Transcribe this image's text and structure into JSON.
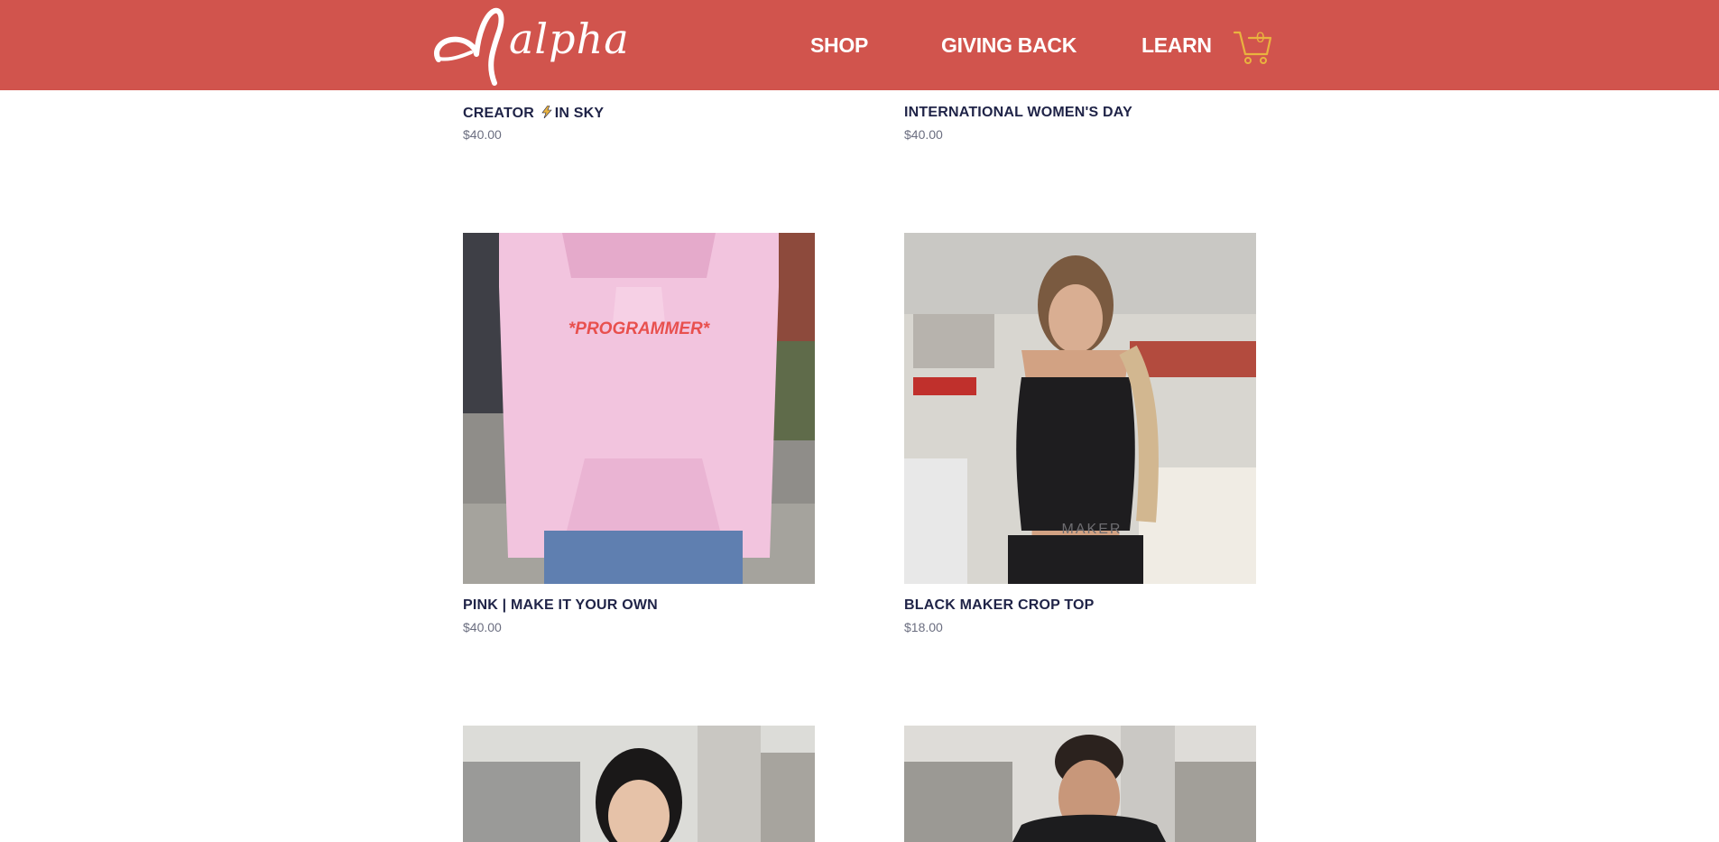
{
  "header": {
    "logo_text": "alpha",
    "nav": {
      "shop": "SHOP",
      "giving_back": "GIVING BACK",
      "learn": "LEARN"
    },
    "cart_count": "0"
  },
  "colors": {
    "header_bg": "#d1544d",
    "cart_accent": "#e9b33f",
    "product_name": "#1f2347",
    "price_text": "#6b6e80"
  },
  "products": [
    {
      "name_part1": "CREATOR",
      "name_icon": "lightning-icon",
      "name_part2": "IN SKY",
      "price": "$40.00"
    },
    {
      "name": "INTERNATIONAL WOMEN'S DAY",
      "price": "$40.00"
    },
    {
      "name": "PINK | MAKE IT YOUR OWN",
      "price": "$40.00",
      "image_text": "*PROGRAMMER*"
    },
    {
      "name": "BLACK MAKER CROP TOP",
      "price": "$18.00",
      "image_text": "MAKER"
    },
    {
      "name": "",
      "price": ""
    },
    {
      "name": "",
      "price": ""
    }
  ]
}
